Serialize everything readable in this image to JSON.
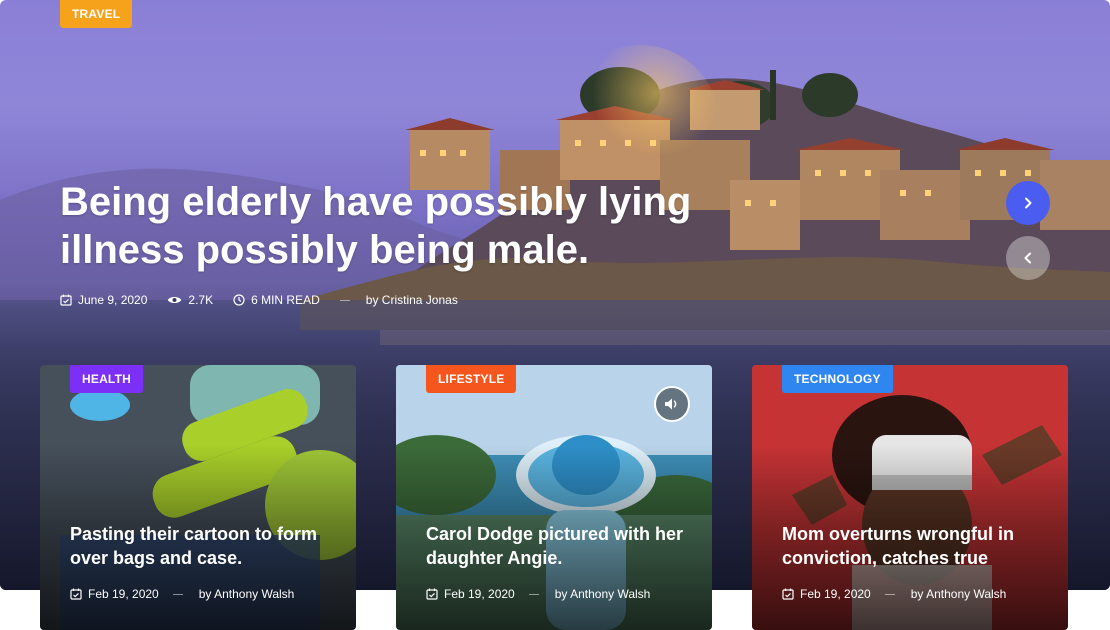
{
  "hero": {
    "category": "TRAVEL",
    "title": "Being elderly have possibly lying illness possibly being male.",
    "date": "June 9, 2020",
    "views": "2.7K",
    "read_time": "6 MIN READ",
    "author": "by Cristina Jonas",
    "next_icon": "chevron-right-icon",
    "prev_icon": "chevron-left-icon"
  },
  "cards": [
    {
      "category": "HEALTH",
      "category_color": "#7b2ff7",
      "title": "Pasting their cartoon to form over bags and case.",
      "date": "Feb 19, 2020",
      "author": "by Anthony Walsh"
    },
    {
      "category": "LIFESTYLE",
      "category_color": "#f5561e",
      "title": "Carol Dodge pictured with her daughter Angie.",
      "date": "Feb 19, 2020",
      "author": "by Anthony Walsh",
      "audio_icon": "speaker-icon"
    },
    {
      "category": "TECHNOLOGY",
      "category_color": "#2f86f0",
      "title": "Mom overturns wrongful in conviction, catches true",
      "date": "Feb 19, 2020",
      "author": "by Anthony Walsh"
    }
  ],
  "colors": {
    "travel": "#f6a21a",
    "accent_blue": "#4b5cf0"
  }
}
